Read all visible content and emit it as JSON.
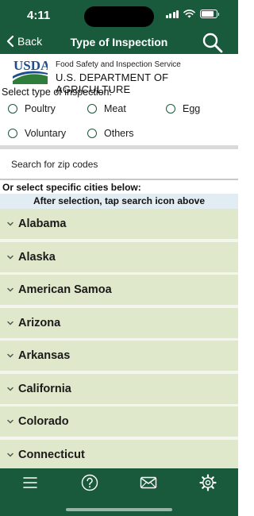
{
  "status_bar": {
    "time": "4:11",
    "icons": [
      "cellular-signal-icon",
      "wifi-icon",
      "battery-icon"
    ]
  },
  "nav": {
    "back_label": "Back",
    "title": "Type of Inspection",
    "search_icon": "search-icon",
    "back_icon": "chevron-left-icon"
  },
  "header": {
    "logo_text": "USDA",
    "agency": "Food Safety and Inspection Service",
    "department": "U.S. DEPARTMENT OF AGRICULTURE"
  },
  "inspection": {
    "label": "Select type of inspection:",
    "options": [
      "Poultry",
      "Meat",
      "Egg",
      "Voluntary",
      "Others"
    ]
  },
  "zip_search": {
    "placeholder": "Search for zip codes",
    "value": ""
  },
  "cities": {
    "label": "Or select specific cities below:",
    "hint": "After selection, tap search icon above",
    "states": [
      "Alabama",
      "Alaska",
      "American Samoa",
      "Arizona",
      "Arkansas",
      "California",
      "Colorado",
      "Connecticut"
    ]
  },
  "tab_bar": {
    "icons": [
      "menu-icon",
      "help-icon",
      "mail-icon",
      "settings-icon"
    ]
  },
  "colors": {
    "brand_green": "#1a5a3c",
    "row_green": "#dfe8ca",
    "hint_blue": "#e2ecf3",
    "logo_blue": "#1f4e8c",
    "logo_green": "#2e7d3a"
  }
}
